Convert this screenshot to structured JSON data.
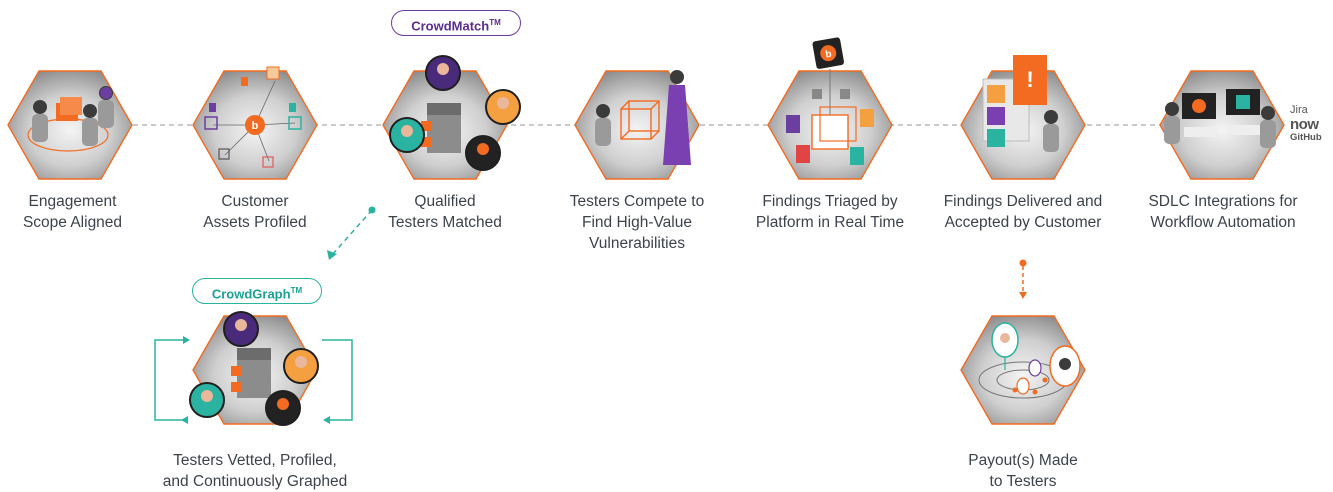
{
  "badges": {
    "crowdmatch": "CrowdMatch",
    "crowdgraph": "CrowdGraph",
    "tm": "TM"
  },
  "steps": [
    {
      "line1": "Engagement",
      "line2": "Scope Aligned"
    },
    {
      "line1": "Customer",
      "line2": "Assets Profiled"
    },
    {
      "line1": "Qualified",
      "line2": "Testers Matched"
    },
    {
      "line1": "Testers Compete to",
      "line2": "Find High-Value",
      "line3": "Vulnerabilities"
    },
    {
      "line1": "Findings Triaged by",
      "line2": "Platform in Real Time"
    },
    {
      "line1": "Findings Delivered and",
      "line2": "Accepted by Customer"
    },
    {
      "line1": "SDLC Integrations for",
      "line2": "Workflow Automation"
    }
  ],
  "side_steps": {
    "vetted": {
      "line1": "Testers Vetted, Profiled,",
      "line2": "and Continuously Graphed"
    },
    "payout": {
      "line1": "Payout(s) Made",
      "line2": "to Testers"
    }
  },
  "integration_logos": {
    "jira": "Jira",
    "now": "now",
    "github": "GitHub"
  },
  "icon_badge_text": "b",
  "colors": {
    "orange": "#f26b21",
    "purple": "#6b3fa0",
    "teal": "#2ab3a0",
    "text": "#3d434b",
    "connector": "#b8b8b8"
  }
}
